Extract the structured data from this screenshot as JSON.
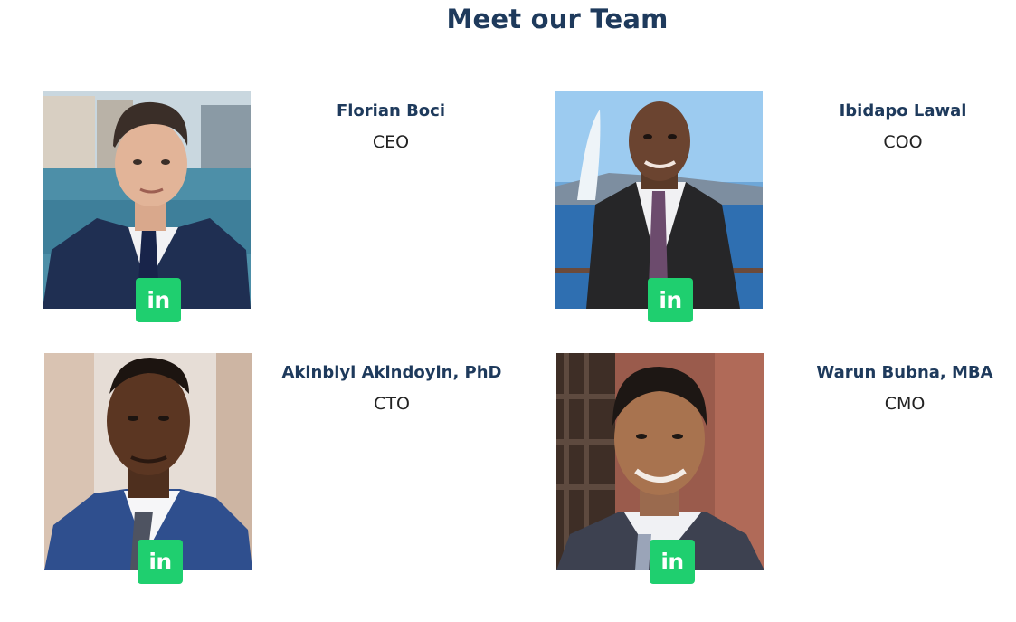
{
  "page": {
    "title": "Meet our Team"
  },
  "team": [
    {
      "name": "Florian Boci",
      "role": "CEO",
      "linkedin_icon": "linkedin-icon",
      "linkedin_label": "in"
    },
    {
      "name": "Ibidapo Lawal",
      "role": "COO",
      "linkedin_icon": "linkedin-icon",
      "linkedin_label": "in"
    },
    {
      "name": "Akinbiyi Akindoyin, PhD",
      "role": "CTO",
      "linkedin_icon": "linkedin-icon",
      "linkedin_label": "in"
    },
    {
      "name": "Warun Bubna, MBA",
      "role": "CMO",
      "linkedin_icon": "linkedin-icon",
      "linkedin_label": "in"
    }
  ],
  "colors": {
    "heading": "#1e3a5c",
    "role_text": "#222222",
    "linkedin_badge": "#1fcf6f",
    "background": "#ffffff"
  }
}
